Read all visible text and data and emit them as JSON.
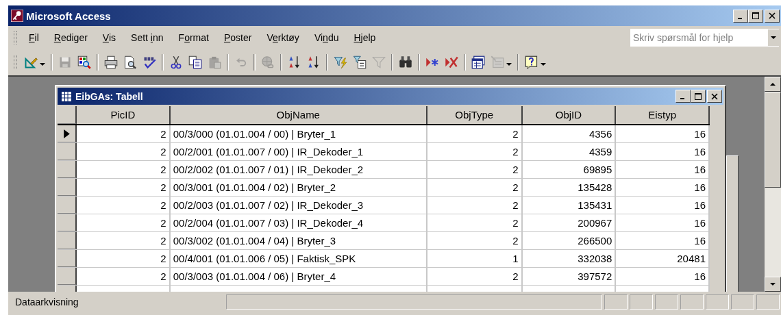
{
  "window": {
    "title": "Microsoft Access"
  },
  "menu": [
    {
      "key": "F",
      "post": "il"
    },
    {
      "key": "R",
      "post": "ediger"
    },
    {
      "key": "V",
      "post": "is"
    },
    {
      "pre": "Sett ",
      "key": "i",
      "post": "nn"
    },
    {
      "pre": "F",
      "key": "o",
      "post": "rmat"
    },
    {
      "key": "P",
      "post": "oster"
    },
    {
      "pre": "V",
      "key": "e",
      "post": "rktøy"
    },
    {
      "pre": "Vi",
      "key": "n",
      "post": "du"
    },
    {
      "key": "H",
      "post": "jelp"
    }
  ],
  "help_search": {
    "placeholder": "Skriv spørsmål for hjelp"
  },
  "toolbar": [
    {
      "kind": "button",
      "disabled": false,
      "dropdown": true
    },
    {
      "kind": "separator"
    },
    {
      "kind": "button",
      "disabled": true,
      "dropdown": false
    },
    {
      "kind": "button",
      "disabled": false,
      "dropdown": false
    },
    {
      "kind": "separator"
    },
    {
      "kind": "button",
      "disabled": false,
      "dropdown": false
    },
    {
      "kind": "button",
      "disabled": false,
      "dropdown": false
    },
    {
      "kind": "button",
      "disabled": false,
      "dropdown": false
    },
    {
      "kind": "separator"
    },
    {
      "kind": "button",
      "disabled": false,
      "dropdown": false
    },
    {
      "kind": "button",
      "disabled": false,
      "dropdown": false
    },
    {
      "kind": "button",
      "disabled": true,
      "dropdown": false
    },
    {
      "kind": "separator"
    },
    {
      "kind": "button",
      "disabled": true,
      "dropdown": false
    },
    {
      "kind": "separator"
    },
    {
      "kind": "button",
      "disabled": true,
      "dropdown": false
    },
    {
      "kind": "separator"
    },
    {
      "kind": "button",
      "disabled": false,
      "dropdown": false
    },
    {
      "kind": "button",
      "disabled": false,
      "dropdown": false
    },
    {
      "kind": "separator"
    },
    {
      "kind": "button",
      "disabled": false,
      "dropdown": false
    },
    {
      "kind": "button",
      "disabled": false,
      "dropdown": false
    },
    {
      "kind": "button",
      "disabled": true,
      "dropdown": false
    },
    {
      "kind": "separator"
    },
    {
      "kind": "button",
      "disabled": false,
      "dropdown": false
    },
    {
      "kind": "separator"
    },
    {
      "kind": "button",
      "disabled": false,
      "dropdown": false
    },
    {
      "kind": "button",
      "disabled": false,
      "dropdown": false
    },
    {
      "kind": "separator"
    },
    {
      "kind": "button",
      "disabled": false,
      "dropdown": false
    },
    {
      "kind": "button",
      "disabled": true,
      "dropdown": true
    },
    {
      "kind": "separator"
    },
    {
      "kind": "button",
      "disabled": false,
      "dropdown": true
    }
  ],
  "datasheet": {
    "title": "EibGAs: Tabell",
    "columns": [
      "PicID",
      "ObjName",
      "ObjType",
      "ObjID",
      "Eistyp"
    ],
    "rows": [
      {
        "selected": true,
        "cells": [
          "2",
          "00/3/000 (01.01.004 / 00) | Bryter_1",
          "2",
          "4356",
          "16"
        ]
      },
      {
        "selected": false,
        "cells": [
          "2",
          "00/2/001 (01.01.007 / 00) | IR_Dekoder_1",
          "2",
          "4359",
          "16"
        ]
      },
      {
        "selected": false,
        "cells": [
          "2",
          "00/2/002 (01.01.007 / 01) | IR_Dekoder_2",
          "2",
          "69895",
          "16"
        ]
      },
      {
        "selected": false,
        "cells": [
          "2",
          "00/3/001 (01.01.004 / 02) | Bryter_2",
          "2",
          "135428",
          "16"
        ]
      },
      {
        "selected": false,
        "cells": [
          "2",
          "00/2/003 (01.01.007 / 02) | IR_Dekoder_3",
          "2",
          "135431",
          "16"
        ]
      },
      {
        "selected": false,
        "cells": [
          "2",
          "00/2/004 (01.01.007 / 03) | IR_Dekoder_4",
          "2",
          "200967",
          "16"
        ]
      },
      {
        "selected": false,
        "cells": [
          "2",
          "00/3/002 (01.01.004 / 04) | Bryter_3",
          "2",
          "266500",
          "16"
        ]
      },
      {
        "selected": false,
        "cells": [
          "2",
          "00/4/001 (01.01.006 / 05) | Faktisk_SPK",
          "1",
          "332038",
          "20481"
        ]
      },
      {
        "selected": false,
        "cells": [
          "2",
          "00/3/003 (01.01.004 / 06) | Bryter_4",
          "2",
          "397572",
          "16"
        ]
      }
    ]
  },
  "status_bar": {
    "text": "Dataarkvisning"
  }
}
